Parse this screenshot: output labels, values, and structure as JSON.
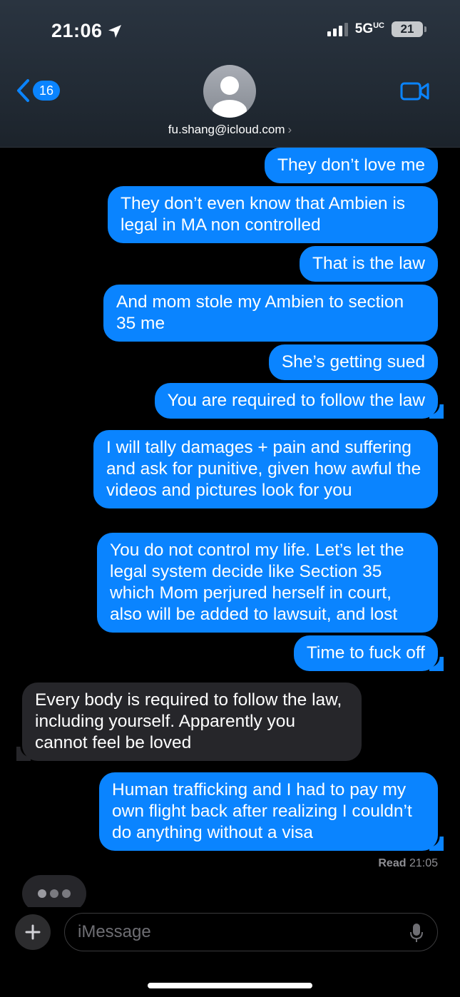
{
  "status": {
    "time": "21:06",
    "network": "5G",
    "network_sub": "UC",
    "battery": "21"
  },
  "header": {
    "back_count": "16",
    "contact": "fu.shang@icloud.com",
    "contact_chevron": "›"
  },
  "messages": [
    {
      "dir": "out",
      "text": "They don’t love me"
    },
    {
      "dir": "out",
      "text": "They don’t even know that Ambien is legal in MA non controlled"
    },
    {
      "dir": "out",
      "text": "That is the law"
    },
    {
      "dir": "out",
      "text": "And mom stole my Ambien to section 35 me"
    },
    {
      "dir": "out",
      "text": "She’s getting sued"
    },
    {
      "dir": "out",
      "text": "You are required to follow the law"
    },
    {
      "dir": "out",
      "text": "I will tally damages + pain and suffering and ask for punitive, given how awful the videos and pictures look for you"
    },
    {
      "dir": "out",
      "text": "You do not control my life. Let’s let the legal system decide like Section 35 which Mom perjured herself in court, also will be added to lawsuit, and lost"
    },
    {
      "dir": "out",
      "text": "Time to fuck off"
    },
    {
      "dir": "in",
      "text": "Every body is required to follow the law, including yourself. Apparently you cannot feel be loved"
    },
    {
      "dir": "out",
      "text": "Human trafficking and I had to pay my own flight back after realizing I couldn’t do anything without a visa"
    }
  ],
  "receipt": {
    "label": "Read",
    "time": "21:05"
  },
  "input": {
    "placeholder": "iMessage"
  },
  "colors": {
    "outgoing": "#0a84ff",
    "incoming": "#26262a",
    "background": "#000000"
  }
}
